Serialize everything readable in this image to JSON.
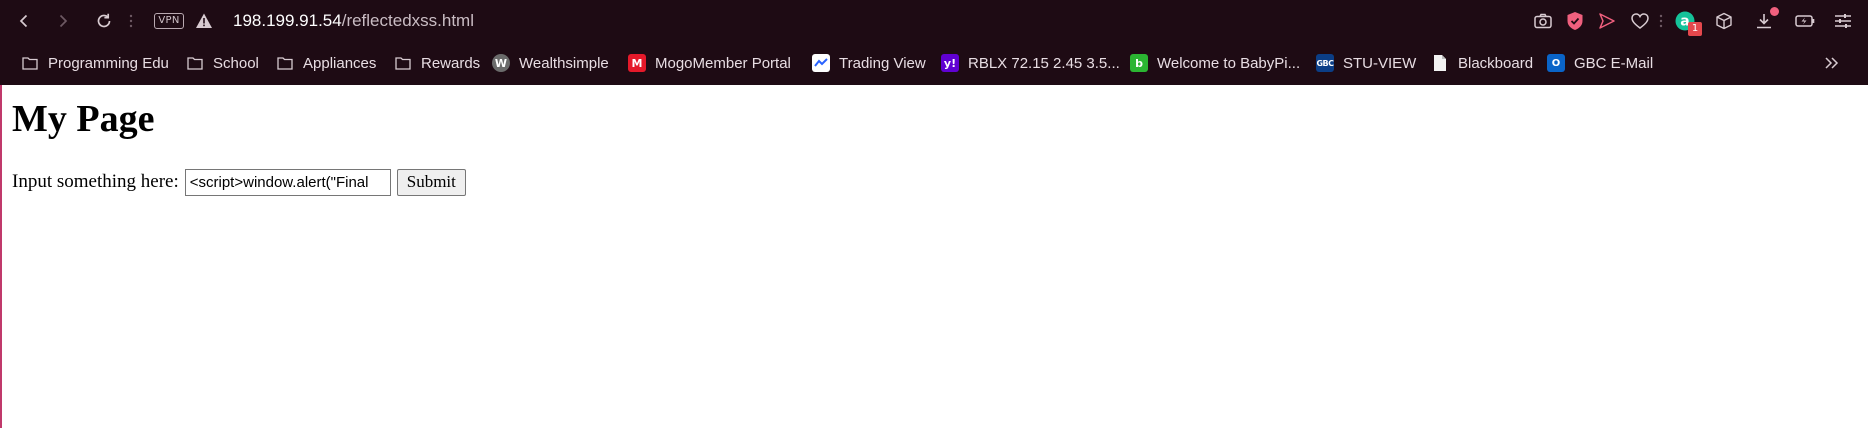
{
  "browser": {
    "vpn_label": "VPN",
    "url_host": "198.199.91.54",
    "url_path": "/reflectedxss.html",
    "extension_badge": "1",
    "colors": {
      "chrome_bg": "#1e0b14",
      "accent": "#f0607e"
    }
  },
  "bookmarks": [
    {
      "label": "Programming Edu",
      "icon": "folder-icon"
    },
    {
      "label": "School",
      "icon": "folder-icon"
    },
    {
      "label": "Appliances",
      "icon": "folder-icon"
    },
    {
      "label": "Rewards",
      "icon": "folder-icon"
    },
    {
      "label": "Wealthsimple",
      "icon": "wealthsimple-favicon"
    },
    {
      "label": "MogoMember Portal",
      "icon": "mogo-favicon"
    },
    {
      "label": "Trading View",
      "icon": "tradingview-favicon"
    },
    {
      "label": "RBLX 72.15 2.45 3.5...",
      "icon": "yahoo-favicon"
    },
    {
      "label": "Welcome to BabyPi...",
      "icon": "babypips-favicon"
    },
    {
      "label": "STU-VIEW",
      "icon": "gbc-favicon"
    },
    {
      "label": "Blackboard",
      "icon": "document-favicon"
    },
    {
      "label": "GBC E-Mail",
      "icon": "outlook-favicon"
    }
  ],
  "page": {
    "title": "My Page",
    "input_label": "Input something here:",
    "input_value": "<script>window.alert(\"Final",
    "submit_label": "Submit"
  }
}
